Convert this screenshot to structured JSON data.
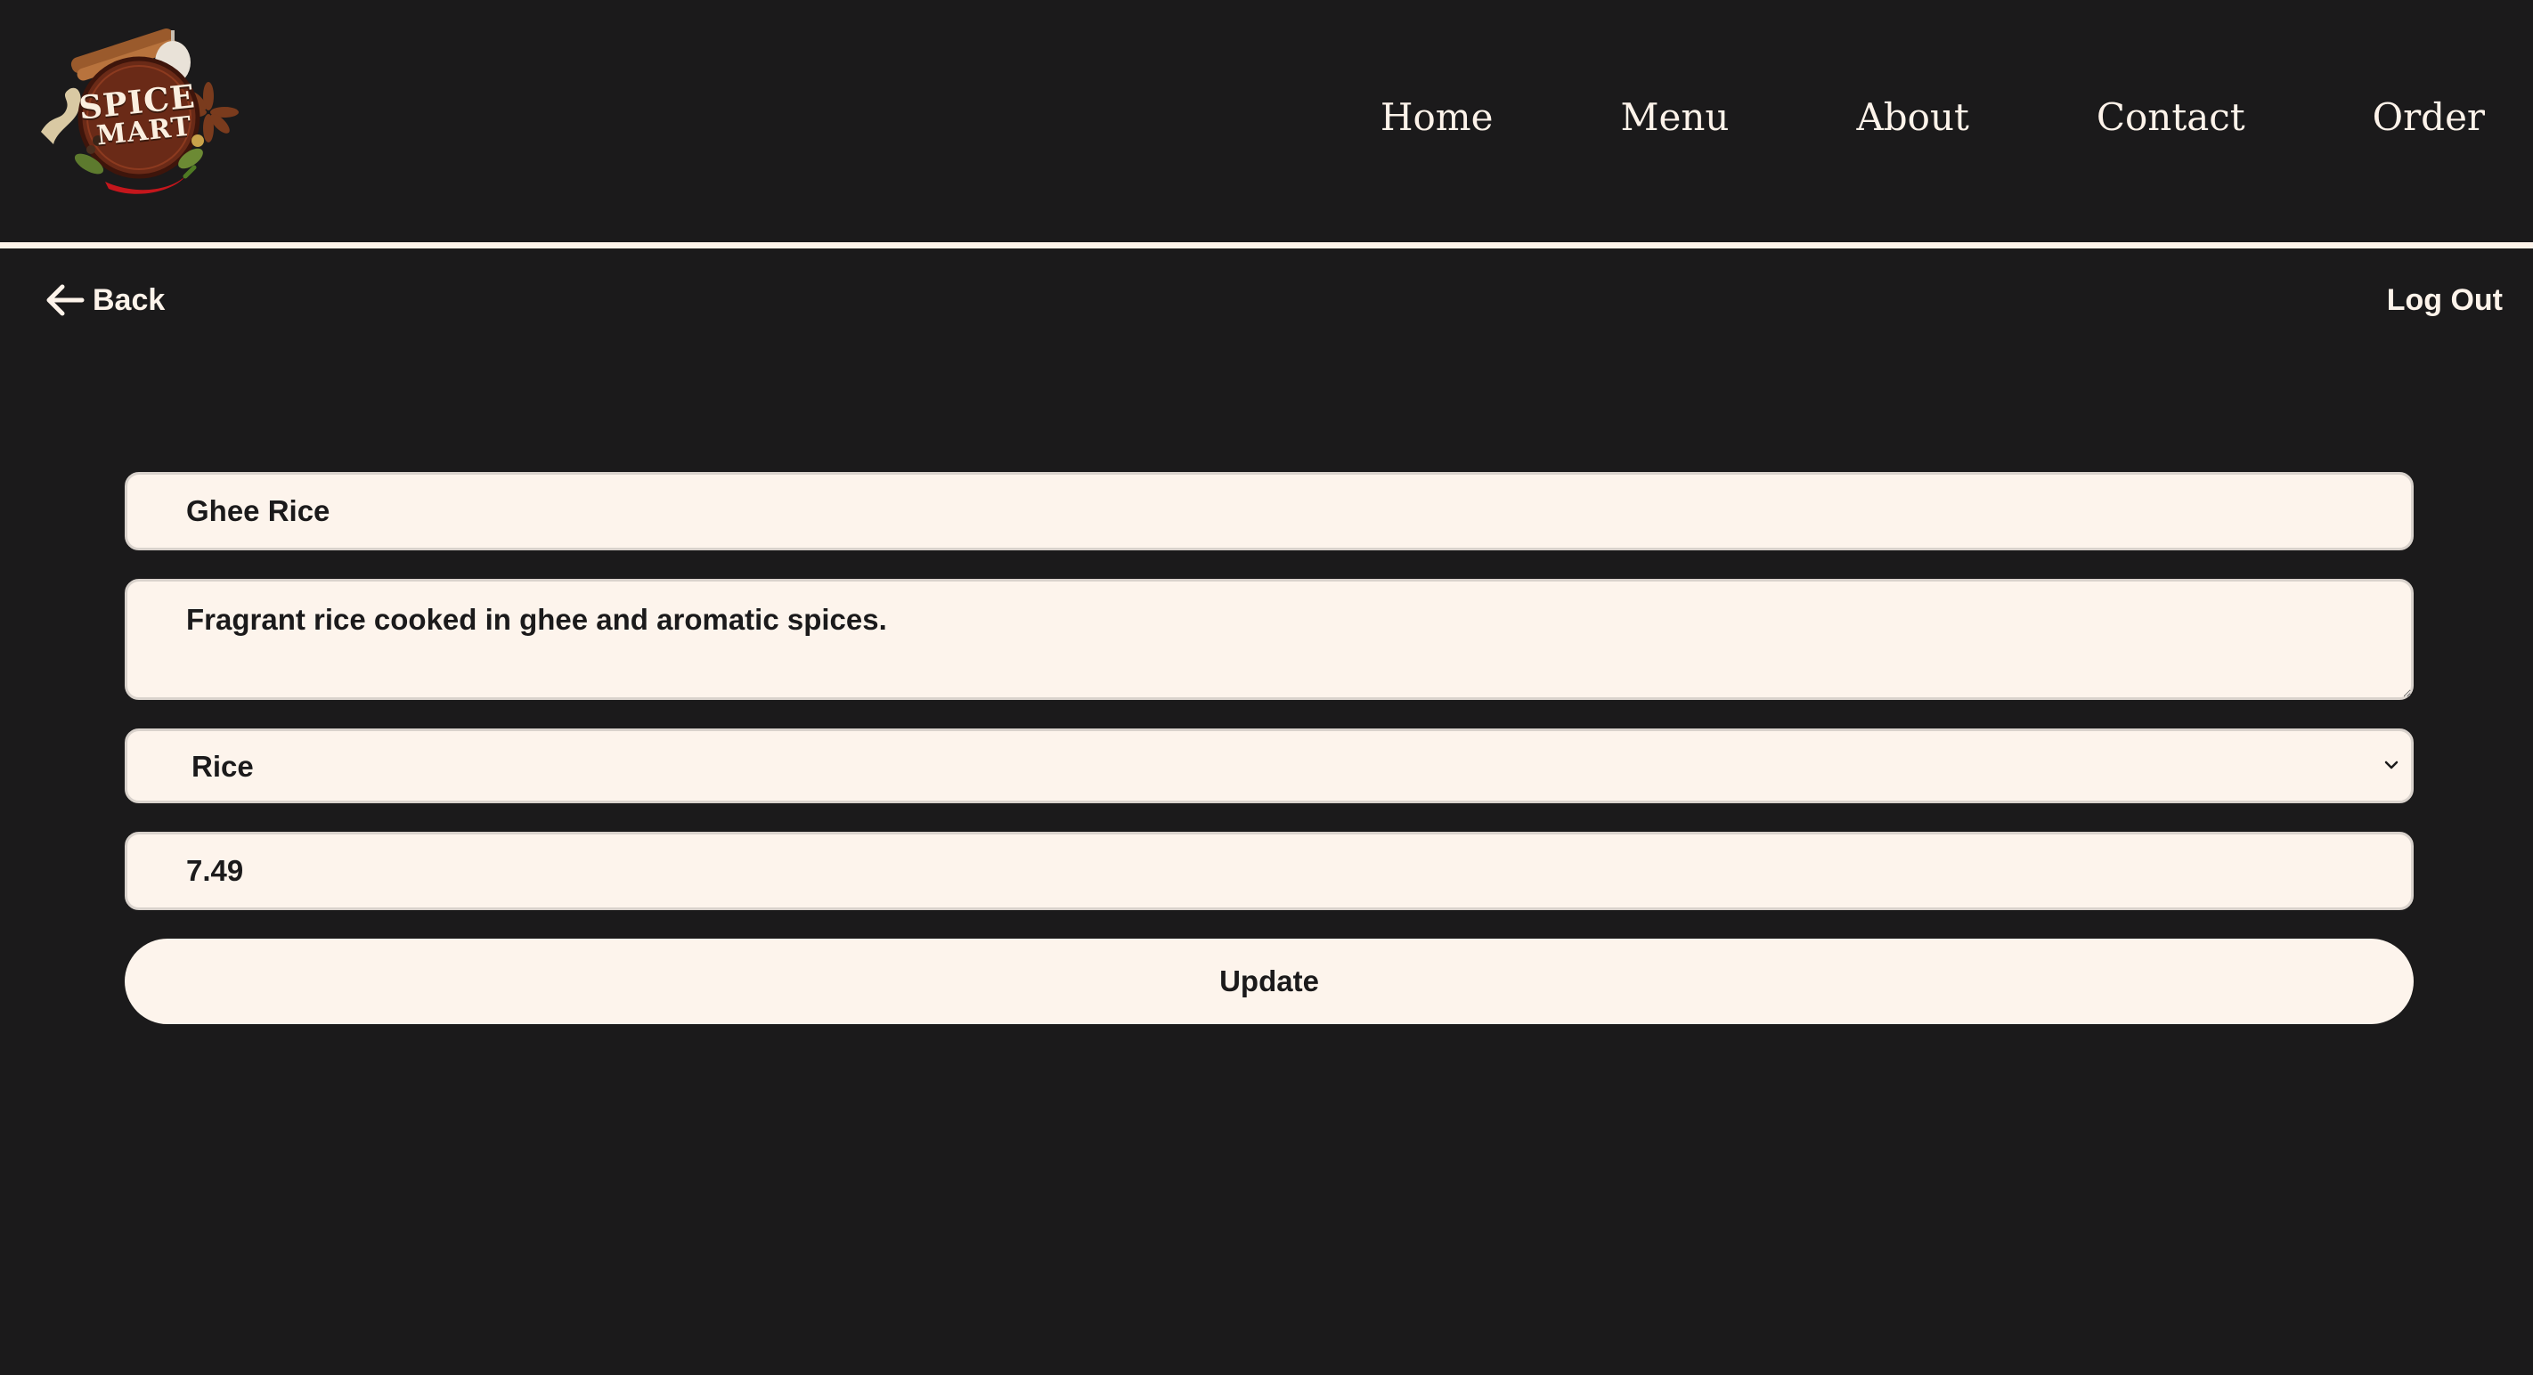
{
  "brand": {
    "logo_line1": "SPICE",
    "logo_line2": "MART",
    "colors": {
      "background": "#1b1a1b",
      "cream": "#fdf4ec",
      "logo_brown": "#6a2a17",
      "logo_red": "#c4161c"
    }
  },
  "nav": {
    "items": [
      {
        "label": "Home"
      },
      {
        "label": "Menu"
      },
      {
        "label": "About"
      },
      {
        "label": "Contact"
      },
      {
        "label": "Order"
      }
    ]
  },
  "subbar": {
    "back_label": "Back",
    "back_icon": "arrow-left-icon",
    "logout_label": "Log Out"
  },
  "form": {
    "name_value": "Ghee Rice",
    "description_value": "Fragrant rice cooked in ghee and aromatic spices.",
    "category_selected": "Rice",
    "category_icon": "chevron-down-icon",
    "price_value": "7.49",
    "submit_label": "Update"
  }
}
